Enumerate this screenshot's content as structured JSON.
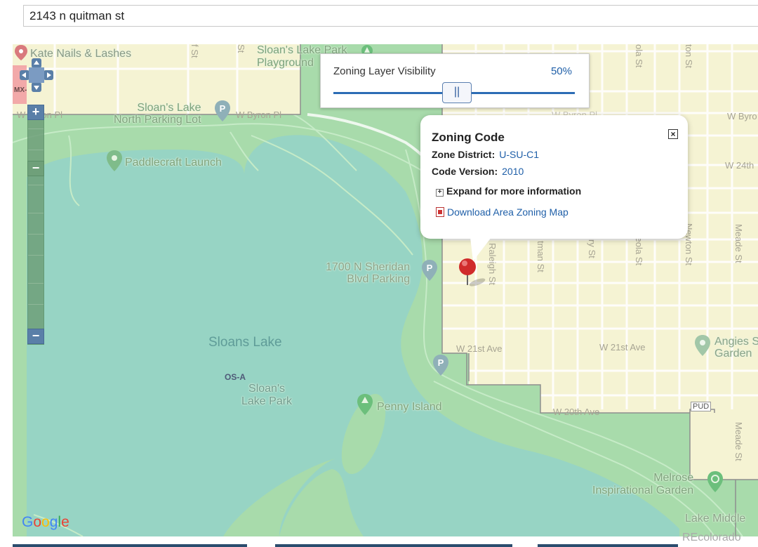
{
  "search": {
    "value": "2143 n quitman st"
  },
  "map": {
    "colors": {
      "land": "#f5f3d3",
      "park": "#a8dbab",
      "water": "#97d4c4",
      "zone_red": "#f2a1a4",
      "zone_line": "#9c9c9c"
    },
    "labels": {
      "kate_nails": "Kate Nails & Lashes",
      "sloans_lake_park_playground_1": "Sloan's Lake Park",
      "sloans_lake_park_playground_2": "Playground",
      "sloans_lake_north_parking_1": "Sloan's Lake",
      "sloans_lake_north_parking_2": "North Parking Lot",
      "w_byron_pl_left": "W Byron Pl",
      "w_byron_pl_mid": "W Byron Pl",
      "w_byron_pl_right": "W Byro",
      "w_byron_pl_faint": "W Byron Pl",
      "paddlecraft_launch": "Paddlecraft Launch",
      "sheridan_parking_1": "1700 N Sheridan",
      "sheridan_parking_2": "Blvd Parking",
      "sloans_lake": "Sloans Lake",
      "os_a": "OS-A",
      "sloans_lake_park_1": "Sloan's",
      "sloans_lake_park_2": "Lake Park",
      "penny_island": "Penny Island",
      "w_21st_ave_1": "W 21st Ave",
      "w_21st_ave_2": "W 21st Ave",
      "w_20th_ave": "W 20th Ave",
      "w_24th": "W 24th",
      "pud": "PUD",
      "angies_1": "Angies S",
      "angies_2": "Garden",
      "melrose_1": "Melrose",
      "melrose_2": "Inspirational Garden",
      "lake_middle": "Lake Middle",
      "raleigh_st": "Raleigh St",
      "quitman_st": "tman St",
      "perry_st": "ry St",
      "osceola_st": "ceola St",
      "newton_st": "Newton St",
      "meade_st_1": "Meade St",
      "meade_st_2": "Meade St",
      "top_st_1": "f St",
      "top_st_2": "St",
      "top_st_3": "ola St",
      "top_st_4": "ton St",
      "mx": "MX-"
    }
  },
  "zoning_layer": {
    "title": "Zoning Layer Visibility",
    "percent_label": "50%",
    "value_fraction": 0.5,
    "thumb_glyph": "||"
  },
  "zoning_popup": {
    "title": "Zoning Code",
    "zone_district_label": "Zone District:",
    "zone_district_value": "U-SU-C1",
    "code_version_label": "Code Version:",
    "code_version_value": "2010",
    "expand_label": "Expand for more information",
    "download_label": "Download Area Zoning Map",
    "close_glyph": "×"
  },
  "zoom": {
    "plus": "+",
    "minus_top": "−",
    "minus": "−"
  },
  "google_logo": {
    "letters": [
      "G",
      "o",
      "o",
      "g",
      "l",
      "e"
    ],
    "colors": [
      "#4285f4",
      "#ea4335",
      "#fbbc05",
      "#4285f4",
      "#34a853",
      "#ea4335"
    ]
  },
  "credit": "REcolorado"
}
